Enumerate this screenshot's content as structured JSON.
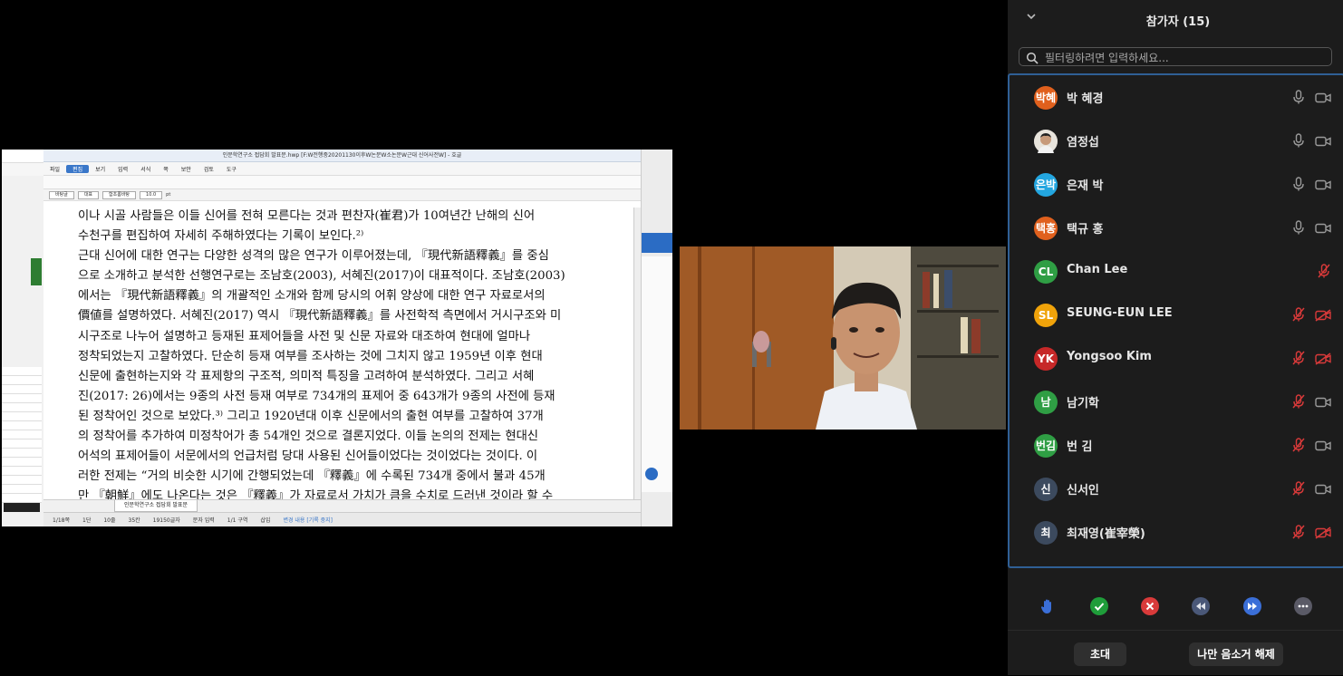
{
  "shared_screen": {
    "window_title": "인문학연구소 접담회 발표문.hwp [F:W전행중20201130이후W논문W소논문W근대 신어사전W] - 호글",
    "menu": [
      "파일",
      "편집",
      "보기",
      "입력",
      "서식",
      "쪽",
      "보안",
      "검토",
      "도구"
    ],
    "active_menu": "편집",
    "style_box": "바탕글",
    "rep_box": "대표",
    "font_box": "함초롬바탕",
    "size_box": "10.0",
    "size_unit": "pt",
    "doc_lines": [
      "이나 시골 사람들은 이들 신어를 전혀 모른다는 것과 편찬자(崔君)가 10여년간 난해의 신어",
      "수천구를 편집하여 자세히 주해하였다는 기록이 보인다.²⁾",
      "  근대 신어에 대한 연구는 다양한 성격의 많은 연구가 이루어졌는데, 『現代新語釋義』를 중심",
      "으로 소개하고 분석한 선행연구로는 조남호(2003), 서혜진(2017)이 대표적이다. 조남호(2003)",
      "에서는 『現代新語釋義』의 개괄적인 소개와 함께 당시의 어휘 양상에 대한 연구 자료로서의",
      "價値를 설명하였다. 서혜진(2017) 역시 『現代新語釋義』를 사전학적 측면에서 거시구조와 미",
      "시구조로 나누어 설명하고 등재된 표제어들을 사전 및 신문 자료와 대조하여 현대에 얼마나",
      "정착되었는지 고찰하였다. 단순히 등재 여부를 조사하는 것에 그치지 않고 1959년 이후 현대",
      "신문에 출현하는지와 각 표제항의 구조적, 의미적 특징을 고려하여 분석하였다. 그리고 서혜",
      "진(2017: 26)에서는 9종의 사전 등재 여부로 734개의 표제어 중 643개가 9종의 사전에 등재",
      "된 정착어인 것으로 보았다.³⁾ 그리고 1920년대 이후 신문에서의 출현 여부를 고찰하여 37개",
      "의 정착어를 추가하여 미정착어가 총 54개인 것으로 결론지었다. 이들 논의의 전제는 현대신",
      "어석의 표제어들이 서문에서의 언급처럼 당대 사용된 신어들이었다는 것이었다는 것이다. 이",
      "러한 전제는 “거의 비슷한 시기에 간행되었는데 『釋義』에 수록된 734개 중에서 불과 45개",
      "만 『朝鮮』에도 나온다는 것은 『釋義』가 자료로서 가치가 큼을 수치로 드러낸 것이라 할 수"
    ],
    "tab_label": "인문학연구소 접담회 발표문",
    "status": [
      "1/18쪽",
      "1단",
      "10줄",
      "35칸",
      "19150글자",
      "문자 입력",
      "1/1 구역",
      "삽입",
      "변경 내용 [기록 중지]"
    ]
  },
  "panel": {
    "title": "참가자 (15)",
    "filter_placeholder": "필터링하려면 입력하세요...",
    "participants": [
      {
        "initials": "박혜",
        "name": "박 혜경",
        "color": "#e0601d",
        "mic": "on",
        "video": "on"
      },
      {
        "initials": "",
        "name": "염정섭",
        "color": "#888888",
        "mic": "on",
        "video": "on",
        "photo": true
      },
      {
        "initials": "은박",
        "name": "은재 박",
        "color": "#23a6e0",
        "mic": "on",
        "video": "on"
      },
      {
        "initials": "택홍",
        "name": "택규 홍",
        "color": "#e0601d",
        "mic": "on",
        "video": "on"
      },
      {
        "initials": "CL",
        "name": "Chan Lee",
        "color": "#2f9e44",
        "mic": "off",
        "video": "none"
      },
      {
        "initials": "SL",
        "name": "SEUNG-EUN LEE",
        "color": "#f0a30a",
        "mic": "off",
        "video": "off"
      },
      {
        "initials": "YK",
        "name": "Yongsoo Kim",
        "color": "#c62828",
        "mic": "off",
        "video": "off"
      },
      {
        "initials": "남",
        "name": "남기학",
        "color": "#2f9e44",
        "mic": "off",
        "video": "on"
      },
      {
        "initials": "번김",
        "name": "번 김",
        "color": "#2f9e44",
        "mic": "off",
        "video": "on"
      },
      {
        "initials": "신",
        "name": "신서인",
        "color": "#3c4a5e",
        "mic": "off",
        "video": "on"
      },
      {
        "initials": "최",
        "name": "최재영(崔宰榮)",
        "color": "#3c4a5e",
        "mic": "off",
        "video": "off"
      }
    ],
    "reactions": [
      {
        "name": "raise-hand",
        "color": "#3b6fd8"
      },
      {
        "name": "yes",
        "color": "#1f9d3a"
      },
      {
        "name": "no",
        "color": "#d93a3a"
      },
      {
        "name": "go-slower",
        "color": "#4a5878"
      },
      {
        "name": "go-faster",
        "color": "#3b6fd8"
      },
      {
        "name": "more",
        "color": "#5a5a66"
      }
    ],
    "invite_label": "초대",
    "unmute_me_label": "나만 음소거 해제"
  }
}
